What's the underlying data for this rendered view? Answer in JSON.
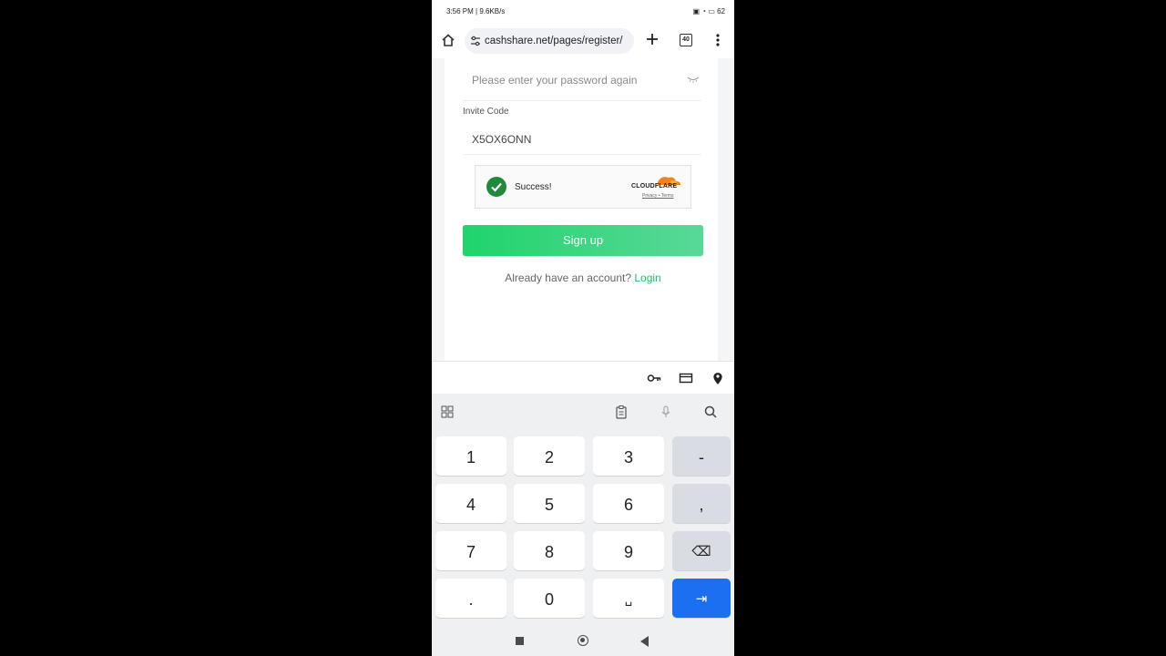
{
  "status_bar": {
    "time": "3:56 PM | 9.6KB/s",
    "icons": "▣ ◔ ▭ 62"
  },
  "browser": {
    "url": "cashshare.net/pages/register/",
    "tab_count": "40"
  },
  "form": {
    "password_again_placeholder": "Please enter your password again",
    "invite_label": "Invite Code",
    "invite_value": "X5OX6ONN",
    "captcha_status": "Success!",
    "captcha_brand": "CLOUDFLARE",
    "captcha_links": "Privacy • Terms",
    "signup_label": "Sign up",
    "already_text": "Already have an account?",
    "login_link": "Login"
  },
  "keyboard": {
    "rows": [
      [
        "1",
        "2",
        "3",
        "-"
      ],
      [
        "4",
        "5",
        "6",
        ","
      ],
      [
        "7",
        "8",
        "9",
        "⌫"
      ],
      [
        ".",
        "0",
        "␣",
        "⇥"
      ]
    ]
  },
  "colors": {
    "accent": "#1fd46b",
    "login": "#1fc066",
    "enter": "#1d6ff2",
    "check": "#1f8a3c"
  }
}
